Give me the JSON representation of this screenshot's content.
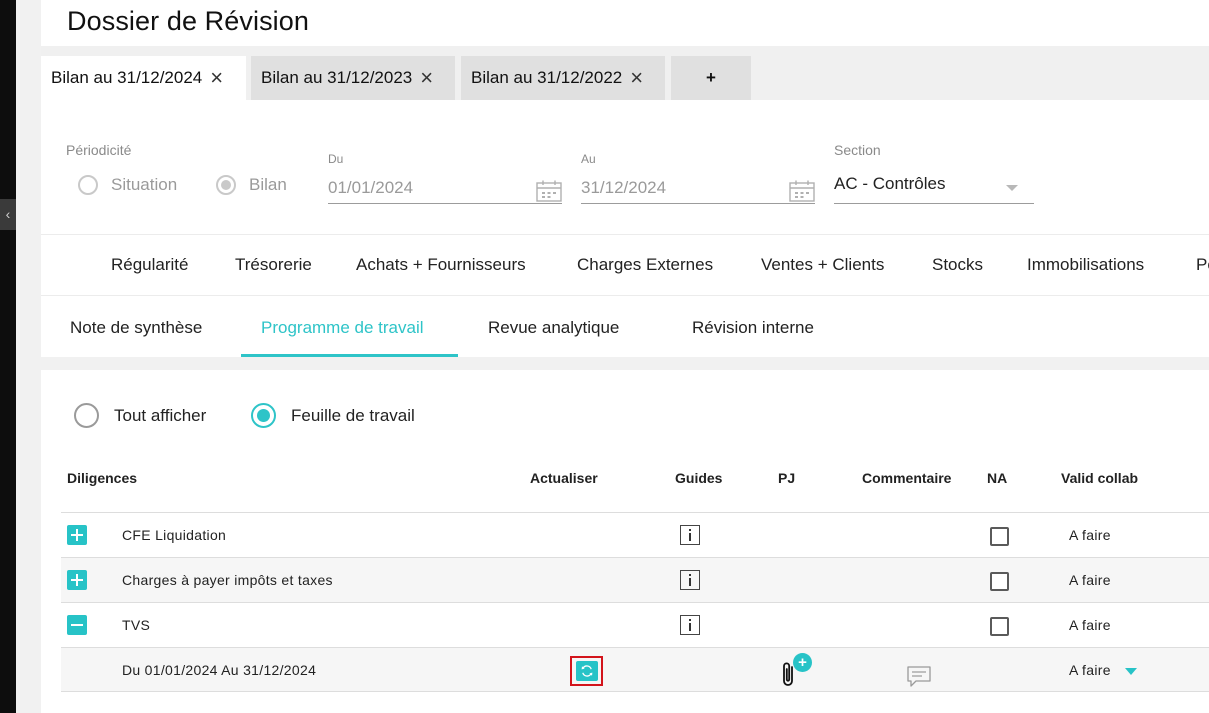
{
  "page": {
    "title": "Dossier de Révision"
  },
  "doc_tabs": [
    {
      "label": "Bilan au 31/12/2024",
      "active": true
    },
    {
      "label": "Bilan au 31/12/2023",
      "active": false
    },
    {
      "label": "Bilan au 31/12/2022",
      "active": false
    }
  ],
  "add_tab_label": "+",
  "filters": {
    "periodicite_label": "Périodicité",
    "periodicite_options": [
      "Situation",
      "Bilan"
    ],
    "periodicite_selected": "Bilan",
    "du_label": "Du",
    "du_value": "01/01/2024",
    "au_label": "Au",
    "au_value": "31/12/2024",
    "section_label": "Section",
    "section_value": "AC - Contrôles"
  },
  "category_tabs": [
    "Régularité",
    "Trésorerie",
    "Achats + Fournisseurs",
    "Charges Externes",
    "Ventes + Clients",
    "Stocks",
    "Immobilisations",
    "Pe"
  ],
  "sub_tabs": [
    "Note de synthèse",
    "Programme de travail",
    "Revue analytique",
    "Révision interne"
  ],
  "sub_tab_active": "Programme de travail",
  "view_options": [
    "Tout afficher",
    "Feuille de travail"
  ],
  "view_selected": "Feuille de travail",
  "table": {
    "columns": [
      "Diligences",
      "Actualiser",
      "Guides",
      "PJ",
      "Commentaire",
      "NA",
      "Valid collab"
    ],
    "rows": [
      {
        "label": "CFE Liquidation",
        "expand": "plus",
        "status": "A faire"
      },
      {
        "label": "Charges à payer impôts et taxes",
        "expand": "plus",
        "status": "A faire"
      },
      {
        "label": "TVS",
        "expand": "minus",
        "status": "A faire"
      },
      {
        "label": "Du 01/01/2024 Au 31/12/2024",
        "expand": "none",
        "status": "A faire"
      }
    ]
  },
  "colors": {
    "accent": "#2ec4c8",
    "highlight_border": "#d3141b",
    "tab_inactive_bg": "#e0e0e0"
  },
  "icons": [
    "chevron-left-icon",
    "close-icon",
    "calendar-icon",
    "chevron-down-icon",
    "info-icon",
    "refresh-icon",
    "paperclip-icon",
    "comment-icon"
  ]
}
